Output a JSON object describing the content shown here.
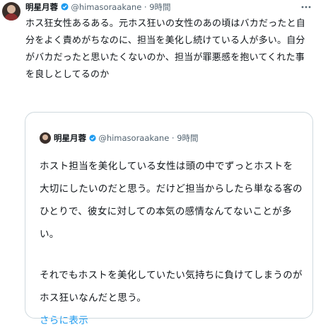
{
  "tweet": {
    "display_name": "明星月蓉",
    "verified_icon": "verified-badge-icon",
    "handle": "@himasoraakane",
    "separator": "·",
    "time": "9時間",
    "more_icon": "more-horizontal-icon",
    "text": "ホス狂女性あるある。元ホス狂いの女性のあの頃はバカだったと自分をよく責めがちなのに、担当を美化し続けている人が多い。自分がバカだったと思いたくないのか、担当が罪悪感を抱いてくれた事を良しとしてるのか"
  },
  "quote": {
    "display_name": "明星月蓉",
    "verified_icon": "verified-badge-icon",
    "handle": "@himasoraakane",
    "separator": "·",
    "time": "9時間",
    "paragraph_1": "ホスト担当を美化している女性は頭の中でずっとホストを大切にしたいのだと思う。だけど担当からしたら単なる客のひとりで、彼女に対しての本気の感情なんてないことが多い。",
    "paragraph_2": "それでもホストを美化していたい気持ちに負けてしまうのがホス狂いなんだと思う。",
    "link_label": "さらに表示"
  }
}
